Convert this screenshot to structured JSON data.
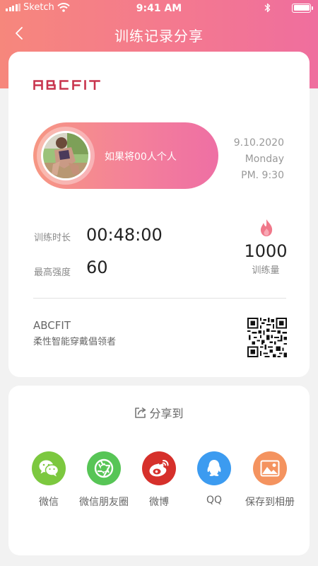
{
  "status_bar": {
    "carrier": "Sketch",
    "time": "9:41 AM"
  },
  "nav": {
    "title": "训练记录分享"
  },
  "brand": {
    "logo": "ABCFIT",
    "name": "ABCFIT",
    "slogan": "柔性智能穿戴倡领者"
  },
  "user": {
    "name": "如果将00人个人"
  },
  "record": {
    "date": "9.10.2020",
    "weekday": "Monday",
    "time": "PM. 9:30",
    "duration_label": "训练时长",
    "duration": "00:48:00",
    "intensity_label": "最高强度",
    "intensity": "60",
    "calories": "1000",
    "calories_label": "训练量"
  },
  "share": {
    "title": "分享到",
    "targets": [
      {
        "label": "微信",
        "icon": "wechat-icon",
        "color": "#7cc83f"
      },
      {
        "label": "微信朋友圈",
        "icon": "moments-icon",
        "color": "#57c556"
      },
      {
        "label": "微博",
        "icon": "weibo-icon",
        "color": "#d6302b"
      },
      {
        "label": "QQ",
        "icon": "qq-icon",
        "color": "#3c9bf0"
      },
      {
        "label": "保存到相册",
        "icon": "album-icon",
        "color": "#f4935f"
      }
    ]
  },
  "colors": {
    "header_start": "#f6877c",
    "header_end": "#ef6e9e",
    "accent": "#ef6a83",
    "logo": "#c8344d"
  }
}
